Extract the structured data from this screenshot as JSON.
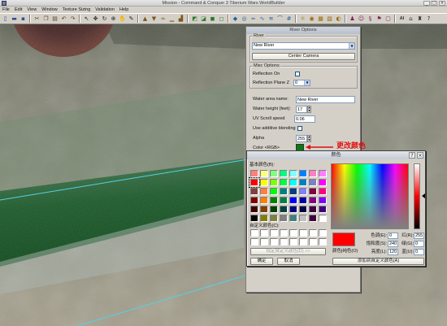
{
  "window": {
    "title": "Mission - Command & Conquer 3 Tiberium Wars WorldBuilder",
    "minimize_icon": "minimize-icon",
    "maximize_icon": "maximize-icon",
    "close_icon": "close-icon"
  },
  "menu": {
    "items": [
      {
        "label": "File"
      },
      {
        "label": "Edit"
      },
      {
        "label": "View"
      },
      {
        "label": "Window"
      },
      {
        "label": "Texture Sizing"
      },
      {
        "label": "Validation"
      },
      {
        "label": "Help"
      }
    ]
  },
  "toolbar": {
    "groups": [
      [
        "new-file-icon",
        "open-folder-icon",
        "save-icon"
      ],
      [
        "cut-icon",
        "copy-icon",
        "paste-icon",
        "undo-icon",
        "redo-icon"
      ],
      [
        "pointer-icon",
        "move-icon",
        "rotate-icon",
        "zoom-icon",
        "hand-icon",
        "eyedropper-icon"
      ],
      [
        "raise-terrain-icon",
        "lower-terrain-icon",
        "smooth-terrain-icon",
        "flatten-terrain-icon",
        "plateau-icon"
      ],
      [
        "paint-texture-icon",
        "blend-texture-icon",
        "fill-texture-icon",
        "eraser-icon"
      ],
      [
        "object-icon",
        "waypoint-icon",
        "road-icon",
        "river-icon",
        "water-icon",
        "bridge-icon",
        "fence-icon"
      ],
      [
        "light-icon",
        "camera-icon",
        "grid-icon",
        "wireframe-icon",
        "shadow-icon"
      ],
      [
        "team-icon",
        "player-icon",
        "script-icon",
        "trigger-icon",
        "area-icon"
      ],
      [
        "ai-icon",
        "building-icon",
        "unit-icon",
        "help-icon"
      ]
    ],
    "ai_label": "AI"
  },
  "river_options": {
    "title": "River Options",
    "river_group": {
      "label": "River",
      "selected_river": "New River",
      "center_camera_label": "Center Camera"
    },
    "misc_group": {
      "label": "Misc Options",
      "reflection_on_label": "Reflection On",
      "reflection_on_checked": false,
      "reflection_plane_z_label": "Reflection Plane Z",
      "reflection_plane_z_value": "0"
    },
    "water_area_name_label": "Water area name:",
    "water_area_name_value": "New River",
    "water_height_label": "Water height (feet):",
    "water_height_value": "17",
    "uv_scroll_speed_label": "UV Scroll speed",
    "uv_scroll_speed_value": "0.06",
    "additive_blending_label": "Use additive blending",
    "additive_blending_checked": false,
    "alpha_label": "Alpha",
    "alpha_value": "255",
    "color_label": "Color <RGB>",
    "color_value": "#0B7A10"
  },
  "annotation": {
    "text": "更改颜色",
    "color": "#E01010"
  },
  "color_dialog": {
    "title": "颜色",
    "help_label": "?",
    "close_label": "×",
    "basic_colors_label": "基本颜色(B):",
    "basic_colors": [
      [
        "#FF8080",
        "#FFFF80",
        "#80FF80",
        "#00FF80",
        "#80FFFF",
        "#0080FF",
        "#FF80C0",
        "#FF80FF"
      ],
      [
        "#FF0000",
        "#FFFF00",
        "#80FF00",
        "#00FF40",
        "#00FFFF",
        "#0080C0",
        "#8080C0",
        "#FF00FF"
      ],
      [
        "#804040",
        "#FF8040",
        "#00FF00",
        "#008080",
        "#004080",
        "#8080FF",
        "#800040",
        "#FF0080"
      ],
      [
        "#800000",
        "#FF8000",
        "#008000",
        "#008040",
        "#0000FF",
        "#0000A0",
        "#800080",
        "#8000FF"
      ],
      [
        "#400000",
        "#804000",
        "#004000",
        "#004040",
        "#000080",
        "#000040",
        "#400040",
        "#400080"
      ],
      [
        "#000000",
        "#808000",
        "#808040",
        "#808080",
        "#408080",
        "#C0C0C0",
        "#400040",
        "#FFFFFF"
      ]
    ],
    "selected_basic_color": "#FF0000",
    "custom_colors_label": "自定义颜色(C):",
    "custom_colors": [
      [
        "#FFFFFF",
        "#FFFFFF",
        "#FFFFFF",
        "#FFFFFF",
        "#FFFFFF",
        "#FFFFFF",
        "#FFFFFF",
        "#FFFFFF"
      ],
      [
        "#FFFFFF",
        "#FFFFFF",
        "#FFFFFF",
        "#FFFFFF",
        "#FFFFFF",
        "#FFFFFF",
        "#FFFFFF",
        "#FFFFFF"
      ]
    ],
    "define_custom_label": "规定自定义颜色(D) >>",
    "ok_label": "确定",
    "cancel_label": "取消",
    "preview_color": "#FF0000",
    "preview_label": "颜色|纯色(O)",
    "hue_label": "色调(E):",
    "hue_value": "0",
    "sat_label": "饱和度(S):",
    "sat_value": "240",
    "lum_label": "亮度(L):",
    "lum_value": "120",
    "red_label": "红(R):",
    "red_value": "255",
    "green_label": "绿(G):",
    "green_value": "0",
    "blue_label": "蓝(U):",
    "blue_value": "0",
    "add_custom_label": "添加到自定义颜色(A)"
  }
}
